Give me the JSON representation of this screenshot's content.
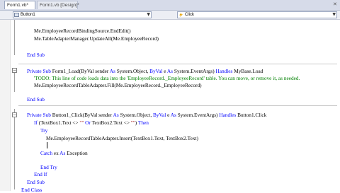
{
  "tabs": [
    {
      "label": "Form1.vb*",
      "active": true
    },
    {
      "label": "Form1.vb [Design]*",
      "active": false
    }
  ],
  "dropdowns": {
    "object": "Button1",
    "event": "Click"
  },
  "code_lines": [
    [
      {
        "t": "Me.EmployeeRecordBindingSource.EndEdit()"
      }
    ],
    [
      {
        "t": "Me.TableAdapterManager.UpdateAll(Me.EmployeeRecord)"
      }
    ],
    [
      {
        "t": "End Sub",
        "c": "kw"
      }
    ],
    [
      {
        "t": "Private Sub ",
        "c": "kw"
      },
      {
        "t": "Form1_Load(ByVal sender "
      },
      {
        "t": "As ",
        "c": "kw"
      },
      {
        "t": "System.Object, "
      },
      {
        "t": "ByVal ",
        "c": "kw"
      },
      {
        "t": "e "
      },
      {
        "t": "As ",
        "c": "kw"
      },
      {
        "t": "System.EventArgs) "
      },
      {
        "t": "Handles ",
        "c": "kw"
      },
      {
        "t": "MyBase.Load"
      }
    ],
    [
      {
        "t": "'TODO: This line of code loads data into the 'EmployeeRecord._EmployeeRecord' table. You can move, or remove it, as needed.",
        "c": "cm"
      }
    ],
    [
      {
        "t": "Me.EmployeeRecordTableAdapter.Fill(Me.EmployeeRecord._EmployeeRecord)"
      }
    ],
    [
      {
        "t": "End Sub",
        "c": "kw"
      }
    ],
    [
      {
        "t": "Private Sub ",
        "c": "kw"
      },
      {
        "t": "Button1_Click(ByVal sender "
      },
      {
        "t": "As ",
        "c": "kw"
      },
      {
        "t": "System.Object, "
      },
      {
        "t": "ByVal ",
        "c": "kw"
      },
      {
        "t": "e "
      },
      {
        "t": "As ",
        "c": "kw"
      },
      {
        "t": "System.EventArgs) "
      },
      {
        "t": "Handles ",
        "c": "kw"
      },
      {
        "t": "Button1.Click"
      }
    ],
    [
      {
        "t": "If ",
        "c": "kw"
      },
      {
        "t": "(TextBox1.Text <> "
      },
      {
        "t": "\"\"",
        "c": "str"
      },
      {
        "t": " "
      },
      {
        "t": "Or ",
        "c": "kw"
      },
      {
        "t": "TextBox2.Text <> "
      },
      {
        "t": "\"\"",
        "c": "str"
      },
      {
        "t": ") "
      },
      {
        "t": "Then",
        "c": "kw"
      }
    ],
    [
      {
        "t": "Try",
        "c": "kw"
      }
    ],
    [
      {
        "t": "Me.EmployeeRecordTableAdapter.Insert(TextBox1.Text, TextBox2.Text)"
      }
    ],
    [
      {
        "t": "Catch ",
        "c": "kw"
      },
      {
        "t": "ex "
      },
      {
        "t": "As ",
        "c": "kw"
      },
      {
        "t": "Exception"
      }
    ],
    [
      {
        "t": "End Try",
        "c": "kw"
      }
    ],
    [
      {
        "t": "End If",
        "c": "kw"
      }
    ],
    [
      {
        "t": "End Sub",
        "c": "kw"
      }
    ],
    [
      {
        "t": "End Class",
        "c": "kw"
      }
    ]
  ]
}
